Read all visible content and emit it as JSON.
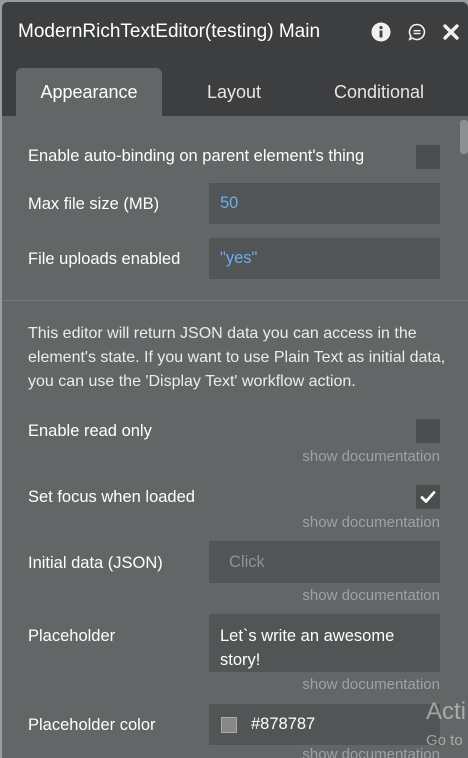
{
  "window": {
    "title": "ModernRichTextEditor(testing) Main",
    "icons": [
      "info-icon",
      "comment-icon",
      "close-icon"
    ]
  },
  "tabs": [
    {
      "label": "Appearance",
      "active": true
    },
    {
      "label": "Layout",
      "active": false
    },
    {
      "label": "Conditional",
      "active": false
    }
  ],
  "fields": {
    "auto_binding": {
      "label": "Enable auto-binding on parent element's thing",
      "checked": false
    },
    "max_file_size": {
      "label": "Max file size (MB)",
      "value": "50"
    },
    "file_uploads": {
      "label": "File uploads enabled",
      "value": "\"yes\""
    },
    "description": "This editor will return JSON data you can access in the element's state. If you want to use Plain Text as initial data, you can use the 'Display Text' workflow action.",
    "read_only": {
      "label": "Enable read only",
      "checked": false,
      "doc": "show documentation"
    },
    "set_focus": {
      "label": "Set focus when loaded",
      "checked": true,
      "doc": "show documentation"
    },
    "initial_data": {
      "label": "Initial data (JSON)",
      "placeholder": "Click",
      "doc": "show documentation"
    },
    "placeholder": {
      "label": "Placeholder",
      "value": "Let`s write an awesome story!",
      "doc": "show documentation"
    },
    "placeholder_color": {
      "label": "Placeholder color",
      "value": "#878787",
      "swatch": "#878787",
      "doc": "show documentation"
    }
  },
  "watermark": {
    "line1": "Acti",
    "line2": "Go to"
  },
  "colors": {
    "accent_value": "#6aaef0",
    "panel": "#636667",
    "titlebar": "#3c3e40"
  }
}
